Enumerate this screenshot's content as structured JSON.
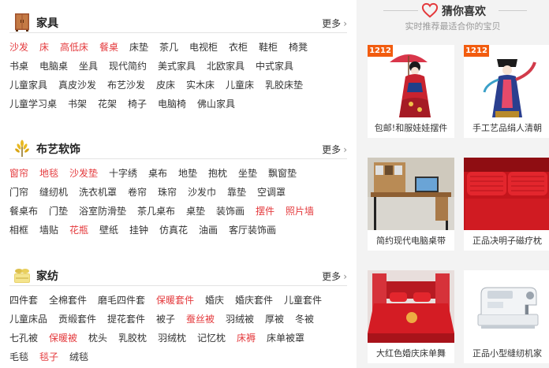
{
  "sections": [
    {
      "title": "家具",
      "more": "更多",
      "arrow": "›",
      "icon": "wardrobe-icon",
      "rows": [
        [
          {
            "t": "沙发",
            "hot": true
          },
          {
            "t": "床",
            "hot": true
          },
          {
            "t": "高低床",
            "hot": true
          },
          {
            "t": "餐桌",
            "hot": true
          },
          {
            "t": "床垫"
          },
          {
            "t": "茶几"
          },
          {
            "t": "电视柜"
          },
          {
            "t": "衣柜"
          },
          {
            "t": "鞋柜"
          },
          {
            "t": "椅凳"
          }
        ],
        [
          {
            "t": "书桌"
          },
          {
            "t": "电脑桌"
          },
          {
            "t": "坐具"
          },
          {
            "t": "现代简约"
          },
          {
            "t": "美式家具"
          },
          {
            "t": "北欧家具"
          },
          {
            "t": "中式家具"
          }
        ],
        [
          {
            "t": "儿童家具"
          },
          {
            "t": "真皮沙发"
          },
          {
            "t": "布艺沙发"
          },
          {
            "t": "皮床"
          },
          {
            "t": "实木床"
          },
          {
            "t": "儿童床"
          },
          {
            "t": "乳胶床垫"
          }
        ],
        [
          {
            "t": "儿童学习桌"
          },
          {
            "t": "书架"
          },
          {
            "t": "花架"
          },
          {
            "t": "椅子"
          },
          {
            "t": "电脑椅"
          },
          {
            "t": "佛山家具"
          }
        ]
      ]
    },
    {
      "title": "布艺软饰",
      "more": "更多",
      "arrow": "›",
      "icon": "wheat-icon",
      "rows": [
        [
          {
            "t": "窗帘",
            "hot": true
          },
          {
            "t": "地毯",
            "hot": true
          },
          {
            "t": "沙发垫",
            "hot": true
          },
          {
            "t": "十字绣"
          },
          {
            "t": "桌布"
          },
          {
            "t": "地垫"
          },
          {
            "t": "抱枕"
          },
          {
            "t": "坐垫"
          },
          {
            "t": "飘窗垫"
          }
        ],
        [
          {
            "t": "门帘"
          },
          {
            "t": "缝纫机"
          },
          {
            "t": "洗衣机罩"
          },
          {
            "t": "卷帘"
          },
          {
            "t": "珠帘"
          },
          {
            "t": "沙发巾"
          },
          {
            "t": "靠垫"
          },
          {
            "t": "空调罩"
          }
        ],
        [
          {
            "t": "餐桌布"
          },
          {
            "t": "门垫"
          },
          {
            "t": "浴室防滑垫"
          },
          {
            "t": "茶几桌布"
          },
          {
            "t": "桌垫"
          },
          {
            "t": "装饰画"
          },
          {
            "t": "摆件",
            "hot": true
          },
          {
            "t": "照片墙",
            "hot": true
          }
        ],
        [
          {
            "t": "相框"
          },
          {
            "t": "墙贴"
          },
          {
            "t": "花瓶",
            "hot": true
          },
          {
            "t": "壁纸"
          },
          {
            "t": "挂钟"
          },
          {
            "t": "仿真花"
          },
          {
            "t": "油画"
          },
          {
            "t": "客厅装饰画"
          }
        ]
      ]
    },
    {
      "title": "家纺",
      "more": "更多",
      "arrow": "›",
      "icon": "bedding-icon",
      "rows": [
        [
          {
            "t": "四件套"
          },
          {
            "t": "全棉套件"
          },
          {
            "t": "磨毛四件套"
          },
          {
            "t": "保暖套件",
            "hot": true
          },
          {
            "t": "婚庆"
          },
          {
            "t": "婚庆套件"
          },
          {
            "t": "儿童套件"
          }
        ],
        [
          {
            "t": "儿童床品"
          },
          {
            "t": "贡缎套件"
          },
          {
            "t": "提花套件"
          },
          {
            "t": "被子"
          },
          {
            "t": "蚕丝被",
            "hot": true
          },
          {
            "t": "羽绒被"
          },
          {
            "t": "厚被"
          },
          {
            "t": "冬被"
          }
        ],
        [
          {
            "t": "七孔被"
          },
          {
            "t": "保暖被",
            "hot": true
          },
          {
            "t": "枕头"
          },
          {
            "t": "乳胶枕"
          },
          {
            "t": "羽绒枕"
          },
          {
            "t": "记忆枕"
          },
          {
            "t": "床褥",
            "hot": true
          },
          {
            "t": "床单被罩"
          }
        ],
        [
          {
            "t": "毛毯"
          },
          {
            "t": "毯子",
            "hot": true
          },
          {
            "t": "绒毯"
          }
        ]
      ]
    }
  ],
  "guess": {
    "title": "猜你喜欢",
    "subtitle": "实时推荐最适合你的宝贝",
    "icon": "heart-icon"
  },
  "products": [
    {
      "caption": "包邮!和服娃娃摆件",
      "badge": "1212",
      "image": "geisha-doll-red-umbrella"
    },
    {
      "caption": "手工艺品绢人清朝",
      "badge": "1212",
      "image": "qing-dynasty-silk-doll"
    },
    {
      "caption": "简约现代电脑桌带",
      "badge": "",
      "image": "wooden-computer-desk"
    },
    {
      "caption": "正品决明子磁疗枕",
      "badge": "",
      "image": "red-pillows"
    },
    {
      "caption": "大红色婚庆床单舞",
      "badge": "",
      "image": "red-wedding-bed"
    },
    {
      "caption": "正品小型缝纫机家",
      "badge": "",
      "image": "white-sewing-machine"
    }
  ],
  "colors": {
    "hot": "#e4393c",
    "badge": "#f25c0f",
    "panel": "#f3f3f3"
  }
}
